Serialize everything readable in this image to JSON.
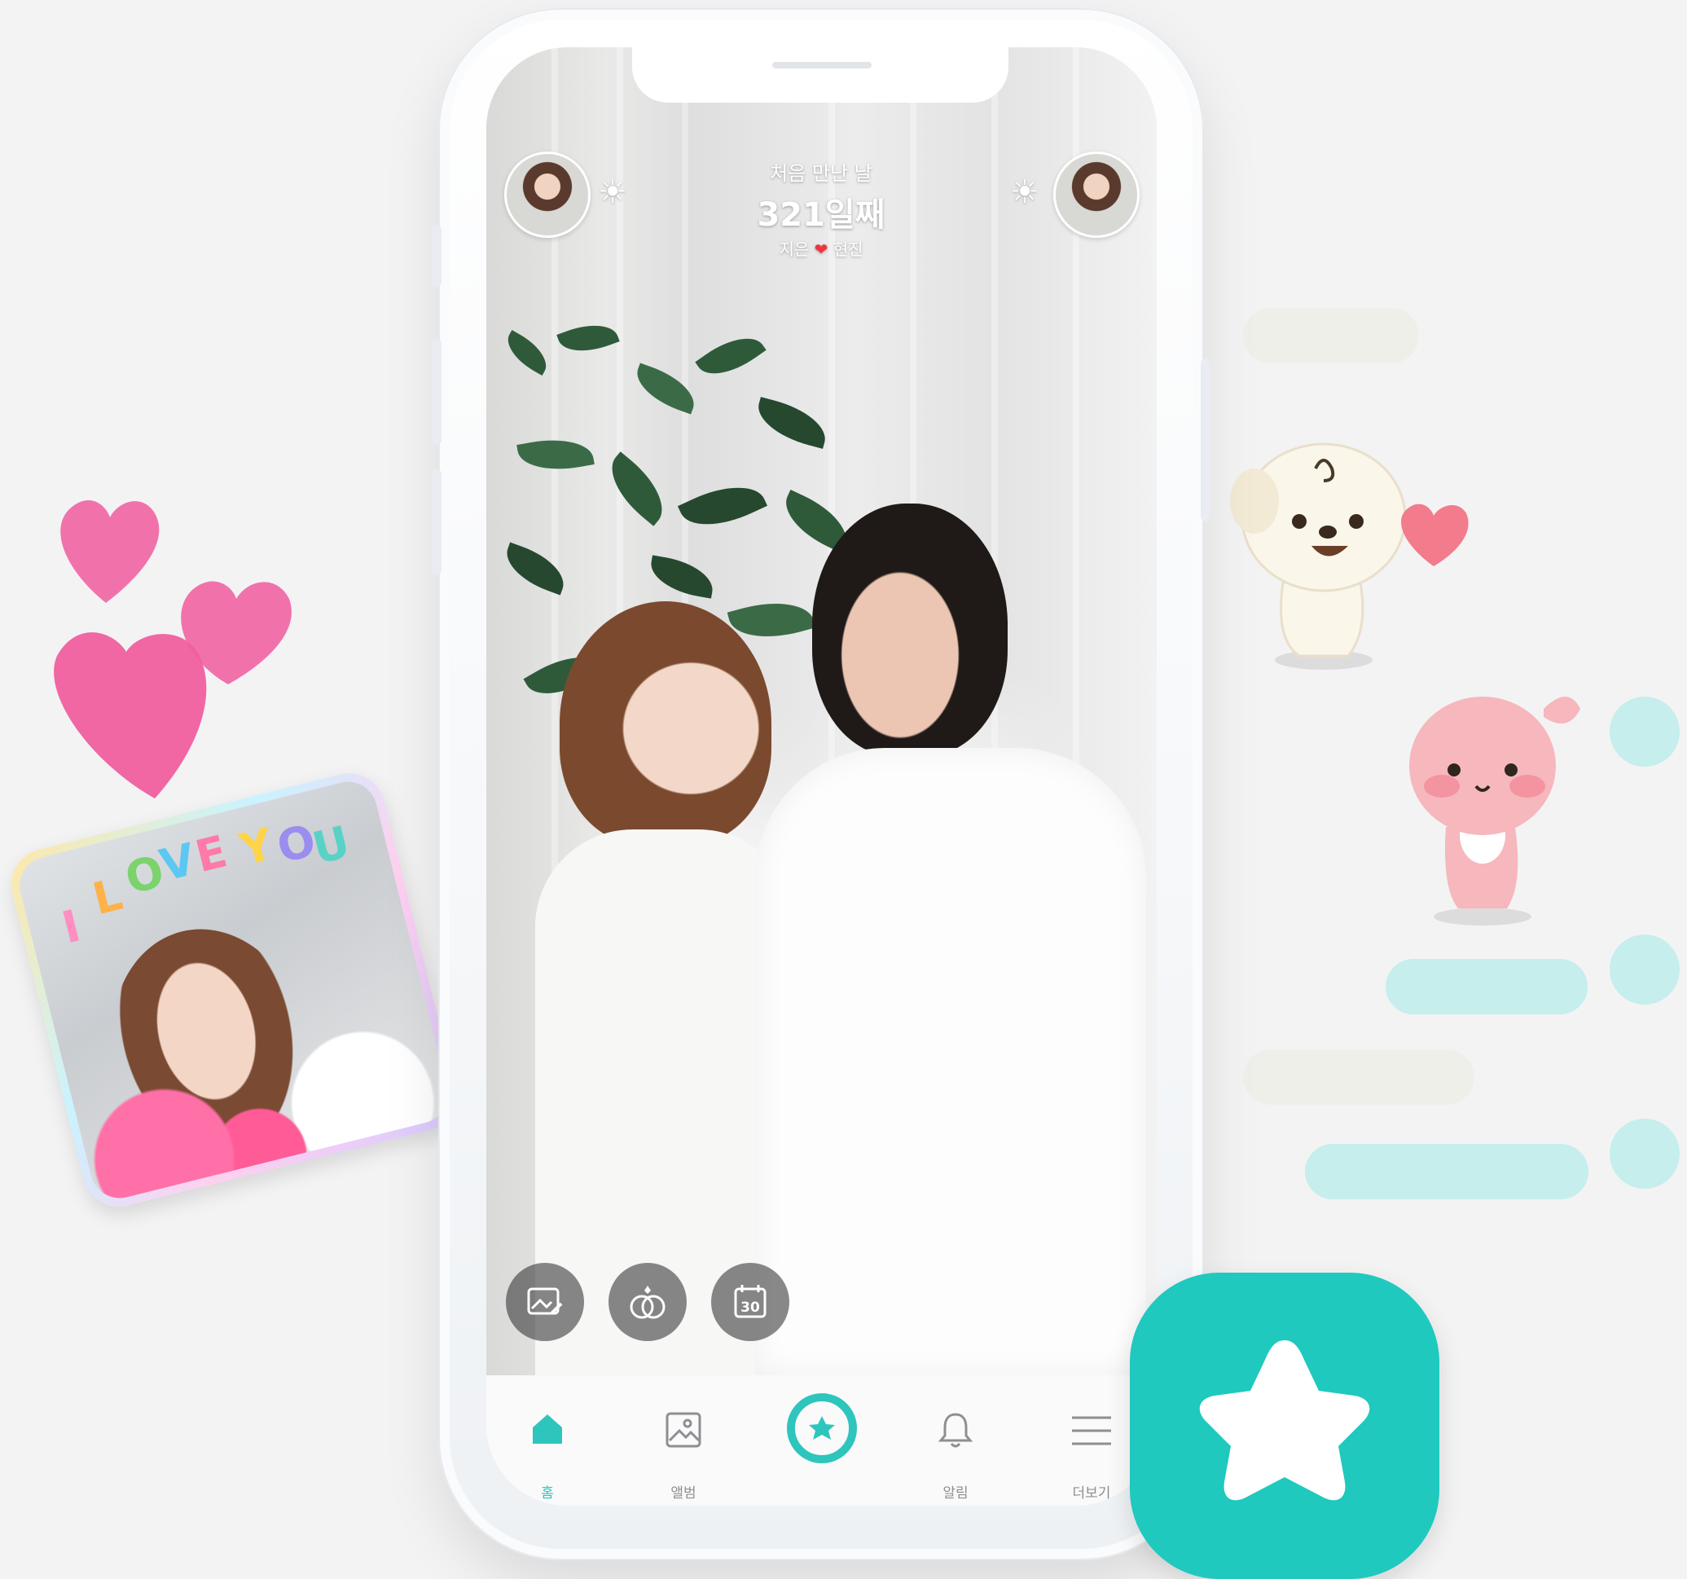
{
  "header": {
    "caption": "처음 만난 날",
    "days": "321일째",
    "partner_left": "지은",
    "partner_right": "현진",
    "heart": "❤"
  },
  "fabs": [
    {
      "icon": "photo-edit-icon"
    },
    {
      "icon": "rings-icon"
    },
    {
      "icon": "calendar-icon",
      "text": "30"
    }
  ],
  "nav": {
    "items": [
      {
        "label": "홈",
        "icon": "home-icon",
        "active": true
      },
      {
        "label": "앨범",
        "icon": "album-icon"
      },
      {
        "label": "",
        "icon": "star-chat-icon"
      },
      {
        "label": "알림",
        "icon": "bell-icon"
      },
      {
        "label": "더보기",
        "icon": "menu-icon"
      }
    ]
  },
  "sticker_card": {
    "text": "I LOVE YOU",
    "letters": [
      "I",
      "L",
      "O",
      "V",
      "E",
      "Y",
      "O",
      "U"
    ]
  },
  "colors": {
    "accent": "#2ec5bd",
    "app_icon": "#1fc9be",
    "heart_pink": "#f06aa6",
    "bubble_gray": "#efefea",
    "bubble_teal": "#c5eeec"
  }
}
